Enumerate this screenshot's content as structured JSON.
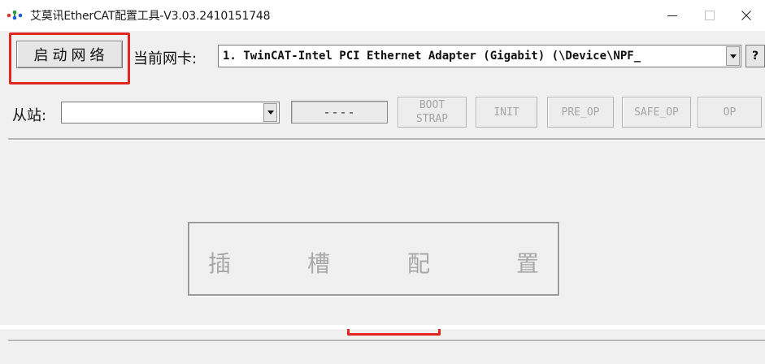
{
  "window": {
    "title": "艾莫讯EtherCAT配置工具-V3.03.2410151748",
    "logo_icon": "app-dots-icon",
    "controls": [
      "minimize-icon",
      "maximize-icon",
      "close-icon"
    ]
  },
  "toolbar": {
    "start_network_label": "启动网络",
    "nic_label": "当前网卡:",
    "nic_selected": "1. TwinCAT-Intel PCI Ethernet Adapter (Gigabit) (\\Device\\NPF_",
    "help_label": "?"
  },
  "slave": {
    "label": "从站:",
    "selected": "",
    "state_value": "----",
    "states": [
      {
        "line1": "BOOT",
        "line2": "STRAP"
      },
      {
        "line1": "INIT"
      },
      {
        "line1": "PRE_OP"
      },
      {
        "line1": "SAFE_OP"
      },
      {
        "line1": "OP"
      }
    ]
  },
  "slot": {
    "chars": [
      "插",
      "槽",
      "配",
      "置"
    ]
  },
  "colors": {
    "highlight": "#e0261e",
    "client_bg": "#f0f0f0",
    "disabled_text": "#a5a5a5"
  }
}
